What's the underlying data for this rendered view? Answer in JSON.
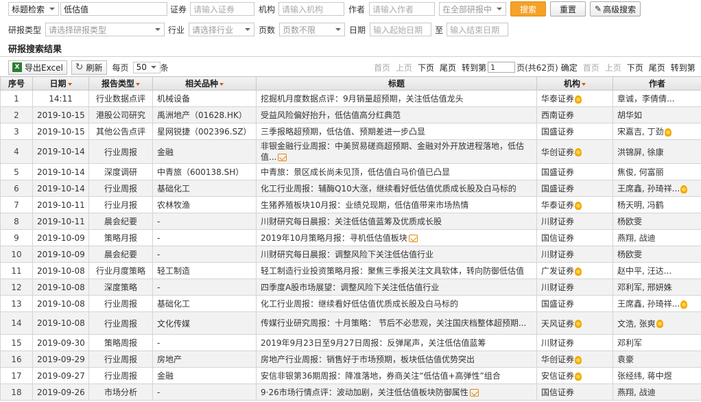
{
  "search": {
    "field_select": "标题检索",
    "keyword": "低估值",
    "security_label": "证券",
    "security_placeholder": "请输入证券",
    "org_label": "机构",
    "org_placeholder": "请输入机构",
    "author_label": "作者",
    "author_placeholder": "请输入作者",
    "scope_select": "在全部研报中",
    "search_button": "搜索",
    "reset_button": "重置",
    "advanced_button": "高级搜索",
    "type_label": "研报类型",
    "type_placeholder": "请选择研报类型",
    "industry_label": "行业",
    "industry_placeholder": "请选择行业",
    "pages_label": "页数",
    "pages_select": "页数不限",
    "date_label": "日期",
    "start_placeholder": "输入起始日期",
    "to_label": "至",
    "end_placeholder": "输入结束日期"
  },
  "results": {
    "title": "研报搜索结果",
    "export_label": "导出Excel",
    "refresh_label": "刷新",
    "per_page_label": "每页",
    "per_page_value": "50",
    "per_page_unit": "条",
    "pager": {
      "first": "首页",
      "prev": "上页",
      "next": "下页",
      "last": "尾页",
      "goto_prefix": "转到第",
      "page_value": "1",
      "goto_suffix": "页(共62页)",
      "confirm": "确定",
      "first2": "首页",
      "prev2": "上页",
      "next2": "下页",
      "last2": "尾页",
      "goto2": "转到第"
    }
  },
  "table": {
    "headers": {
      "index": "序号",
      "date": "日期",
      "type": "报告类型",
      "product": "相关品种",
      "title": "标题",
      "org": "机构",
      "author": "作者"
    },
    "rows": [
      {
        "index": "1",
        "date": "14:11",
        "type": "行业数据点评",
        "product": "机械设备",
        "title": "挖掘机月度数据点评：9月销量超预期，关注低估值龙头",
        "org": "华泰证券",
        "author": "章诚，李倩倩..."
      },
      {
        "index": "2",
        "date": "2019-10-15",
        "type": "港股公司研究",
        "product": "禹洲地产（01628.HK）",
        "title": "受益风险偏好抬升，低估值高分红典范",
        "org": "西南证券",
        "author": "胡华如"
      },
      {
        "index": "3",
        "date": "2019-10-15",
        "type": "其他公告点评",
        "product": "星网锐捷（002396.SZ）",
        "title": "三季报略超预期，低估值、预期差进一步凸显",
        "org": "国盛证券",
        "author": "宋嘉吉, 丁劲"
      },
      {
        "index": "4",
        "date": "2019-10-14",
        "type": "行业周报",
        "product": "金融",
        "title": "非银金融行业周报：中美贸易磋商超预期、金融对外开放进程落地，低估值...",
        "org": "华创证券",
        "author": "洪锦屏, 徐康"
      },
      {
        "index": "5",
        "date": "2019-10-14",
        "type": "深度调研",
        "product": "中青旅（600138.SH）",
        "title": "中青旅：景区成长尚未见顶，低估值白马价值已凸显",
        "org": "国盛证券",
        "author": "焦俊, 何富丽"
      },
      {
        "index": "6",
        "date": "2019-10-14",
        "type": "行业周报",
        "product": "基础化工",
        "title": "化工行业周报：辅酶Q10大涨，继续看好低估值优质成长股及白马标的",
        "org": "国盛证券",
        "author": "王席鑫, 孙琦祥..."
      },
      {
        "index": "7",
        "date": "2019-10-11",
        "type": "行业月报",
        "product": "农林牧渔",
        "title": "生猪养殖板块10月报：业绩兑现期，低估值带来市场热情",
        "org": "华泰证券",
        "author": "杨天明, 冯鹤"
      },
      {
        "index": "8",
        "date": "2019-10-11",
        "type": "晨会纪要",
        "product": "-",
        "title": "川财研究每日晨报：关注低估值蓝筹及优质成长股",
        "org": "川财证券",
        "author": "杨欧雯"
      },
      {
        "index": "9",
        "date": "2019-10-09",
        "type": "策略月报",
        "product": "-",
        "title": "2019年10月策略月报：寻机低估值板块",
        "org": "国信证券",
        "author": "燕翔, 战迪"
      },
      {
        "index": "10",
        "date": "2019-10-09",
        "type": "晨会纪要",
        "product": "-",
        "title": "川财研究每日晨报：调整风险下关注低估值行业",
        "org": "川财证券",
        "author": "杨欧雯"
      },
      {
        "index": "11",
        "date": "2019-10-08",
        "type": "行业月度策略",
        "product": "轻工制造",
        "title": "轻工制造行业投资策略月报：聚焦三季报关注文具软体，转向防御低估值",
        "org": "广发证券",
        "author": "赵中平, 汪达..."
      },
      {
        "index": "12",
        "date": "2019-10-08",
        "type": "深度策略",
        "product": "-",
        "title": "四季度A股市场展望：调整风险下关注低估值行业",
        "org": "川财证券",
        "author": "邓利军, 邢妍姝"
      },
      {
        "index": "13",
        "date": "2019-10-08",
        "type": "行业周报",
        "product": "基础化工",
        "title": "化工行业周报：继续看好低估值优质成长股及白马标的",
        "org": "国盛证券",
        "author": "王席鑫, 孙琦祥..."
      },
      {
        "index": "14",
        "date": "2019-10-08",
        "type": "行业周报",
        "product": "文化传媒",
        "title": "传媒行业研究周报：十月策略： 节后不必悲观，关注国庆档整体超预期...",
        "org": "天风证券",
        "author": "文浩, 张爽"
      },
      {
        "index": "15",
        "date": "2019-09-30",
        "type": "策略周报",
        "product": "-",
        "title": "2019年9月23日至9月27日周报：反弹尾声，关注低估值蓝筹",
        "org": "川财证券",
        "author": "邓利军"
      },
      {
        "index": "16",
        "date": "2019-09-29",
        "type": "行业周报",
        "product": "房地产",
        "title": "房地产行业周报：销售好于市场预期，板块低估值优势突出",
        "org": "华创证券",
        "author": "袁豪"
      },
      {
        "index": "17",
        "date": "2019-09-27",
        "type": "行业周报",
        "product": "金融",
        "title": "安信非银第36期周报：降准落地，券商关注“低估值+高弹性”组合",
        "org": "安信证券",
        "author": "张经纬, 蒋中煜"
      },
      {
        "index": "18",
        "date": "2019-09-26",
        "type": "市场分析",
        "product": "-",
        "title": "9·26市场行情点评：波动加剧，关注低估值板块防御属性",
        "org": "国信证券",
        "author": "燕翔, 战迪"
      }
    ]
  }
}
